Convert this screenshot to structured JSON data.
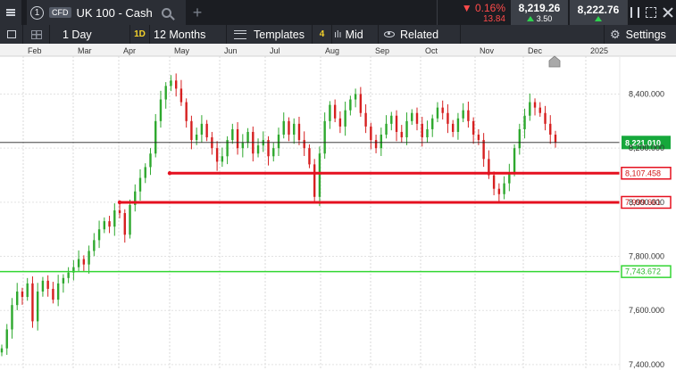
{
  "topbar": {
    "info_label": "1",
    "badge": "CFD",
    "symbol": "UK 100 - Cash",
    "change_pct": "▼ 0.16%",
    "change_abs": "13.84",
    "sell_price": "8,219.26",
    "spread": "3.50",
    "buy_price": "8,222.76"
  },
  "toolbar": {
    "interval": "1 Day",
    "interval_tag": "1D",
    "range": "12 Months",
    "templates": "Templates",
    "indicator_count": "4",
    "price_type": "Mid",
    "related": "Related",
    "settings": "Settings"
  },
  "colors": {
    "up": "#2ea82e",
    "down": "#d62020",
    "green_line": "#33d633",
    "red_line": "#e5101f",
    "current_tag": "#16a83b"
  },
  "chart_data": {
    "type": "candlestick",
    "x_months": [
      "Feb",
      "Mar",
      "Apr",
      "May",
      "Jun",
      "Jul",
      "Aug",
      "Sep",
      "Oct",
      "Nov",
      "Dec",
      "2025"
    ],
    "y_ticks": [
      "8,400.000",
      "8,200.000",
      "8,000.000",
      "7,800.000",
      "7,600.000",
      "7,400.000"
    ],
    "ylim": [
      7380,
      8540
    ],
    "current_price": "8,221.010",
    "horizontal_levels": [
      {
        "label": "8,107.458",
        "value": 8107.458,
        "color": "red",
        "start_month": "Apr"
      },
      {
        "label": "7,999.661",
        "value": 7999.661,
        "color": "red",
        "start_month": "Mar"
      },
      {
        "label": "7,743.672",
        "value": 7743.672,
        "color": "green",
        "start_month": "Jan"
      }
    ],
    "closes": [
      7460,
      7530,
      7620,
      7670,
      7650,
      7700,
      7560,
      7670,
      7710,
      7680,
      7640,
      7700,
      7720,
      7740,
      7760,
      7790,
      7770,
      7820,
      7860,
      7900,
      7930,
      7910,
      7970,
      7960,
      7880,
      7990,
      8040,
      8090,
      8130,
      8180,
      8300,
      8380,
      8430,
      8450,
      8420,
      8370,
      8300,
      8230,
      8250,
      8290,
      8240,
      8200,
      8150,
      8170,
      8230,
      8270,
      8200,
      8220,
      8260,
      8180,
      8210,
      8230,
      8170,
      8200,
      8250,
      8300,
      8250,
      8290,
      8230,
      8200,
      8140,
      8020,
      8180,
      8300,
      8360,
      8310,
      8280,
      8340,
      8380,
      8400,
      8330,
      8280,
      8230,
      8200,
      8250,
      8290,
      8320,
      8260,
      8240,
      8300,
      8330,
      8290,
      8240,
      8270,
      8310,
      8350,
      8330,
      8290,
      8260,
      8310,
      8340,
      8300,
      8250,
      8230,
      8160,
      8100,
      8050,
      8030,
      8070,
      8110,
      8200,
      8270,
      8320,
      8370,
      8350,
      8330,
      8290,
      8250,
      8221
    ]
  }
}
